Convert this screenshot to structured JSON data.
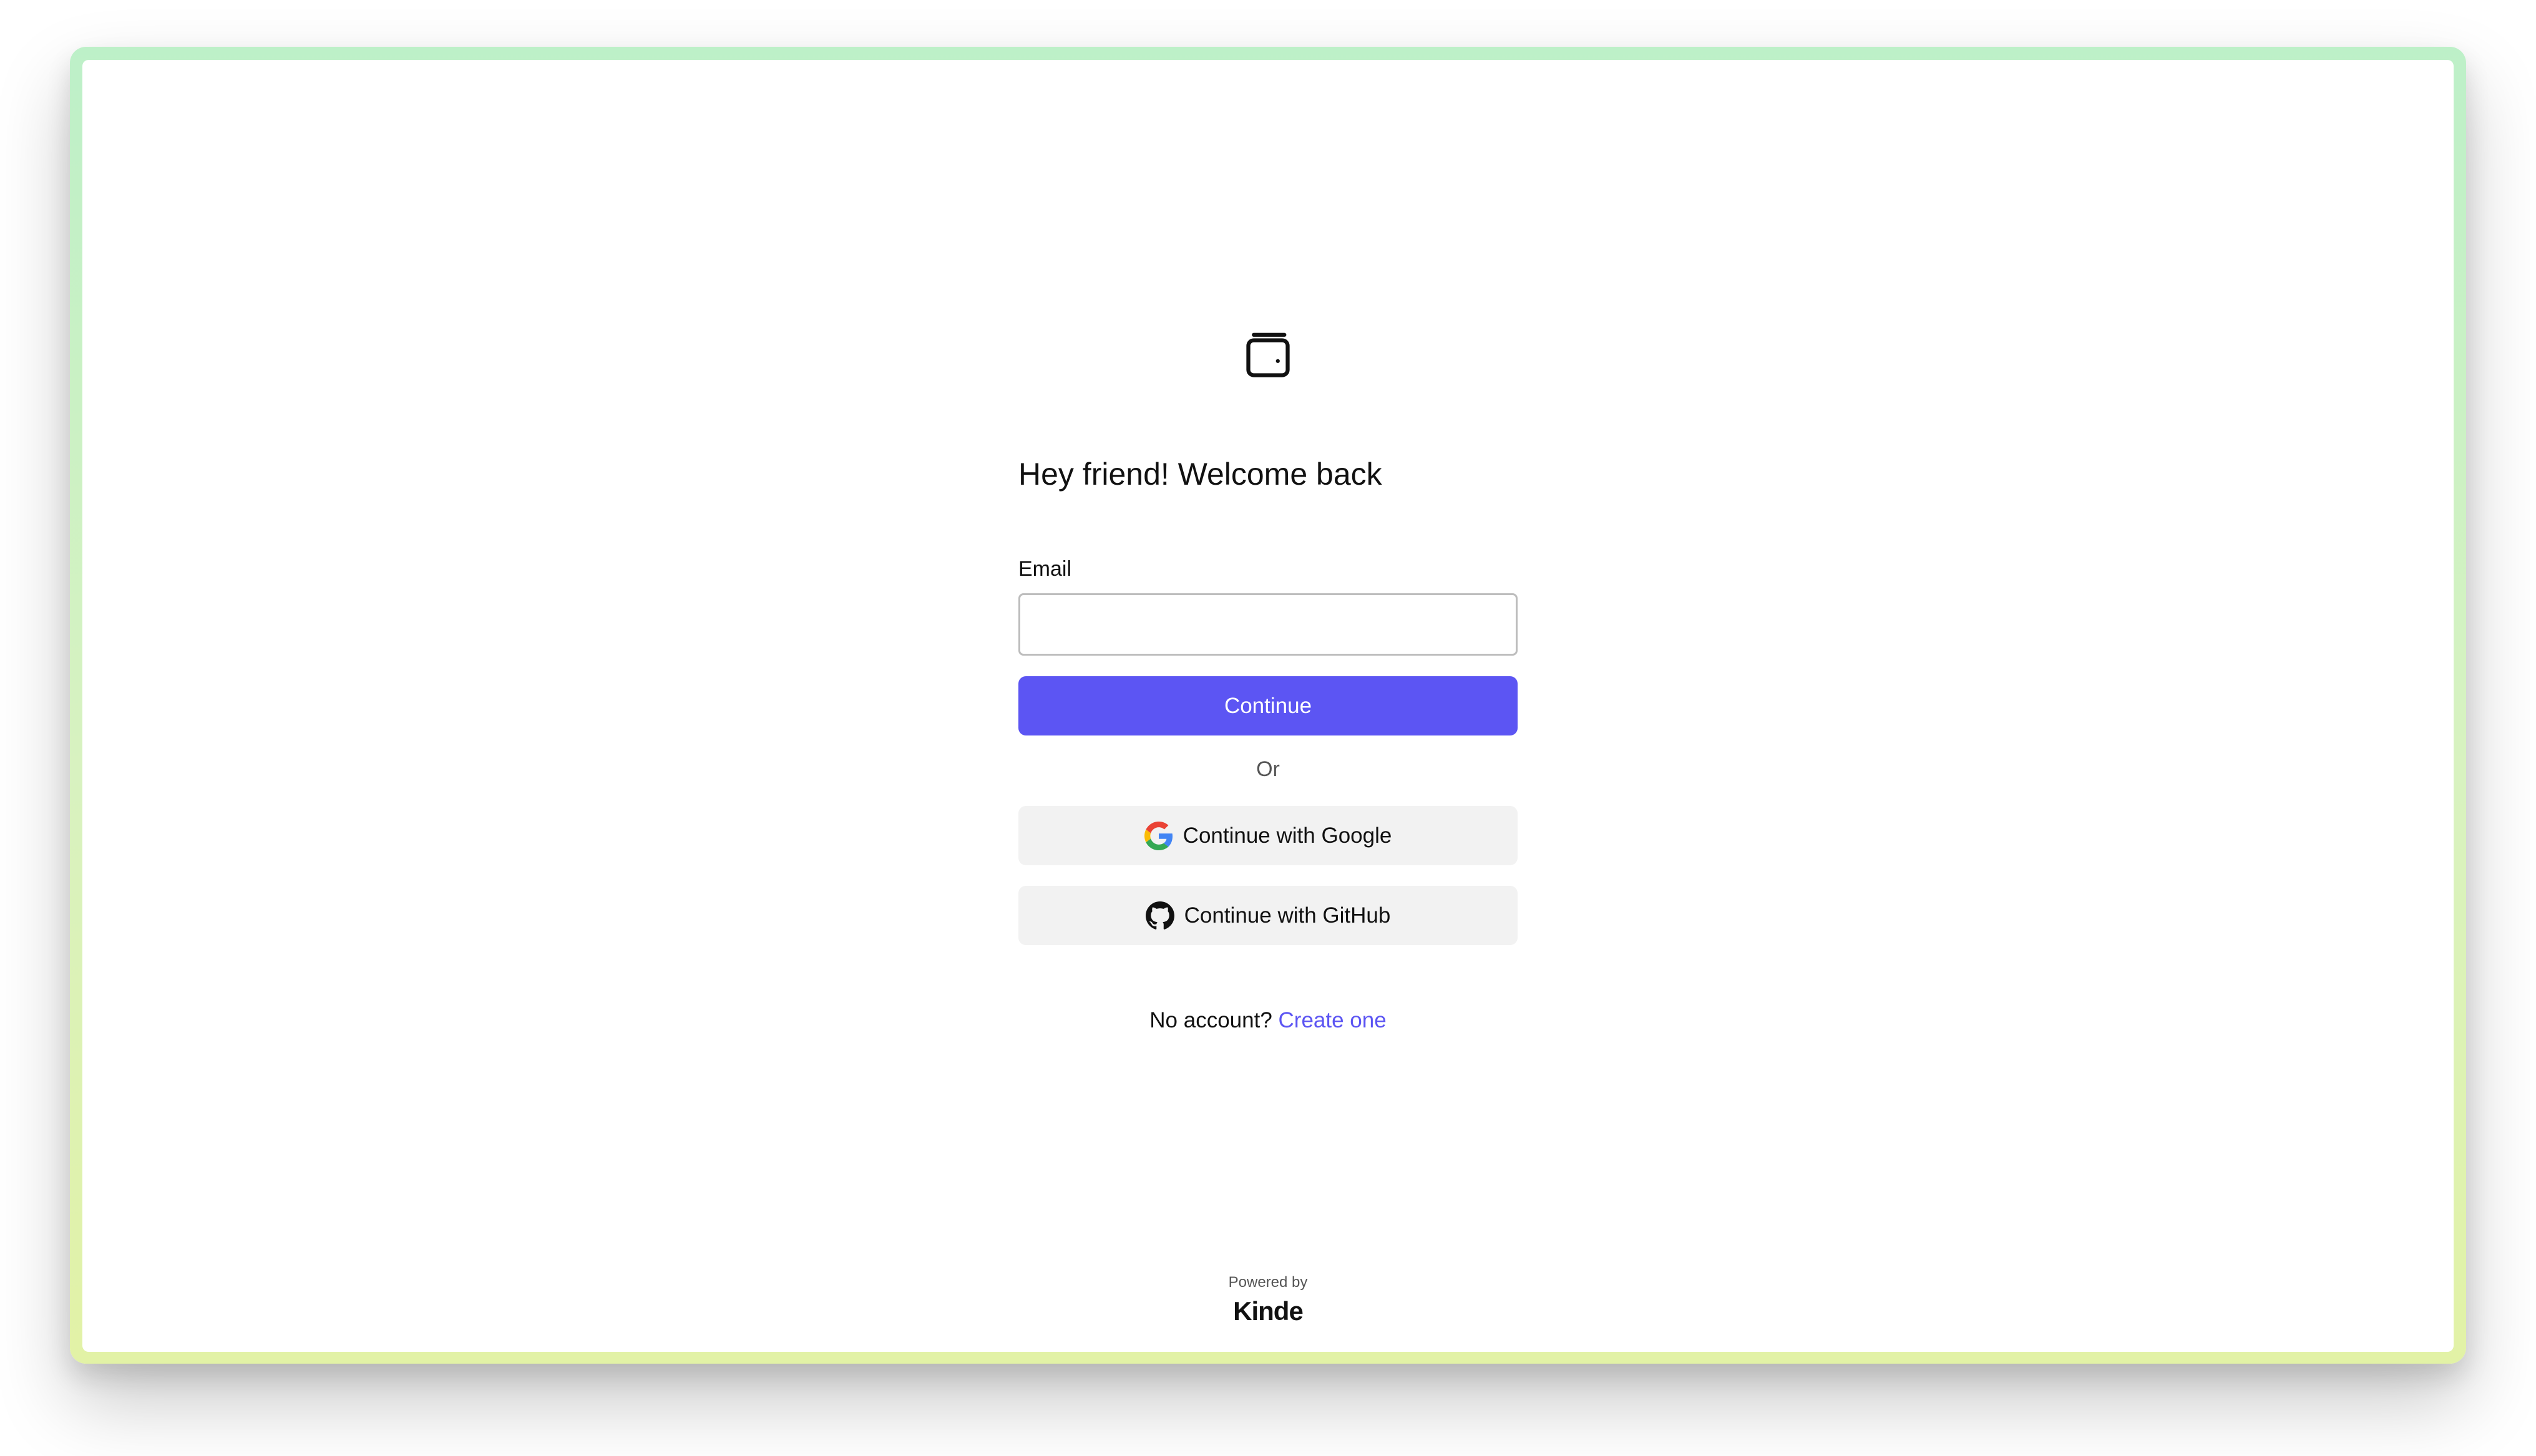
{
  "app": {
    "heading": "Hey friend! Welcome back",
    "logo_icon": "wallet-icon"
  },
  "form": {
    "email_label": "Email",
    "email_value": "",
    "email_placeholder": "",
    "continue_label": "Continue",
    "divider_label": "Or"
  },
  "social": {
    "google_label": "Continue with Google",
    "google_icon": "google-icon",
    "github_label": "Continue with GitHub",
    "github_icon": "github-icon"
  },
  "signup": {
    "prompt": "No account?",
    "link_label": "Create one"
  },
  "footer": {
    "powered_by": "Powered by",
    "brand": "Kinde"
  },
  "colors": {
    "primary": "#5c55f3",
    "social_button_bg": "#f2f2f2",
    "frame_gradient_top": "#bdf0c8",
    "frame_gradient_bottom": "#e2f2a6"
  }
}
